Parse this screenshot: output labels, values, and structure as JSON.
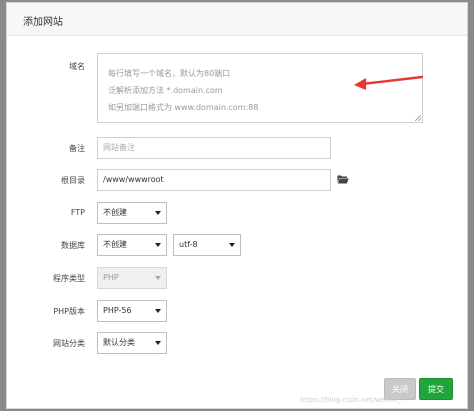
{
  "dialog": {
    "title": "添加网站"
  },
  "form": {
    "domain": {
      "label": "域名",
      "placeholder_lines": [
        "每行填写一个域名，默认为80端口",
        "泛解析添加方法 *.domain.com",
        "如另加端口格式为 www.domain.com:88"
      ]
    },
    "remark": {
      "label": "备注",
      "placeholder": "网站备注"
    },
    "root_dir": {
      "label": "根目录",
      "value": "/www/wwwroot"
    },
    "ftp": {
      "label": "FTP",
      "selected": "不创建"
    },
    "database": {
      "label": "数据库",
      "selected": "不创建",
      "charset": "utf-8"
    },
    "program_type": {
      "label": "程序类型",
      "selected": "PHP"
    },
    "php_version": {
      "label": "PHP版本",
      "selected": "PHP-56"
    },
    "site_category": {
      "label": "网站分类",
      "selected": "默认分类"
    }
  },
  "buttons": {
    "close": "关闭",
    "submit": "提交"
  },
  "watermark": "https://blog.csdn.net/weixin_...",
  "colors": {
    "arrow": "#e8352f",
    "submit": "#20a53a",
    "close": "#c9c9c9"
  },
  "icons": {
    "folder": "folder-open-icon",
    "arrow": "red-arrow-annotation"
  }
}
